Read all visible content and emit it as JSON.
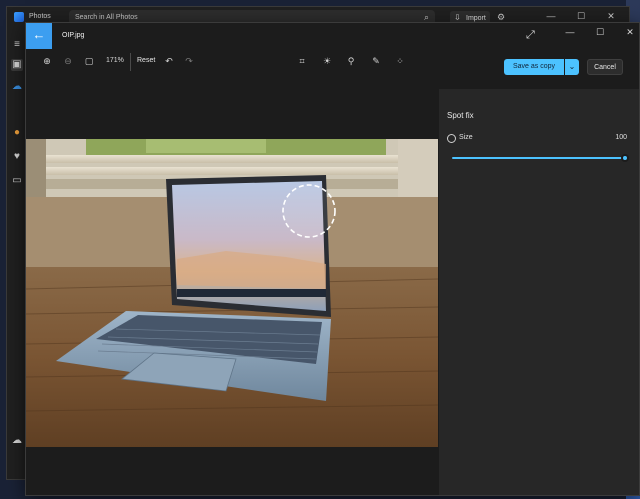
{
  "background_app": {
    "title": "Photos",
    "search_placeholder": "Search in All Photos",
    "import_label": "Import",
    "nav_icons": [
      "hamburger-icon",
      "gallery-icon",
      "onedrive-icon",
      "people-icon",
      "favorites-icon",
      "folder-icon",
      "cloud-icon"
    ]
  },
  "editor": {
    "file_name": "OIP.jpg",
    "toolbar": {
      "zoom_level": "171%",
      "reset_label": "Reset",
      "tools": [
        "crop-icon",
        "adjust-icon",
        "filter-icon",
        "markup-icon",
        "spot-fix-icon"
      ]
    },
    "save_label": "Save as copy",
    "cancel_label": "Cancel",
    "panel": {
      "title": "Spot fix",
      "size_label": "Size",
      "size_value": "100",
      "size_level": 1.0
    }
  },
  "colors": {
    "accent": "#4cc2ff",
    "back_button": "#3c9ef0",
    "window_bg": "#1c1c1c",
    "panel_bg": "#272727"
  }
}
